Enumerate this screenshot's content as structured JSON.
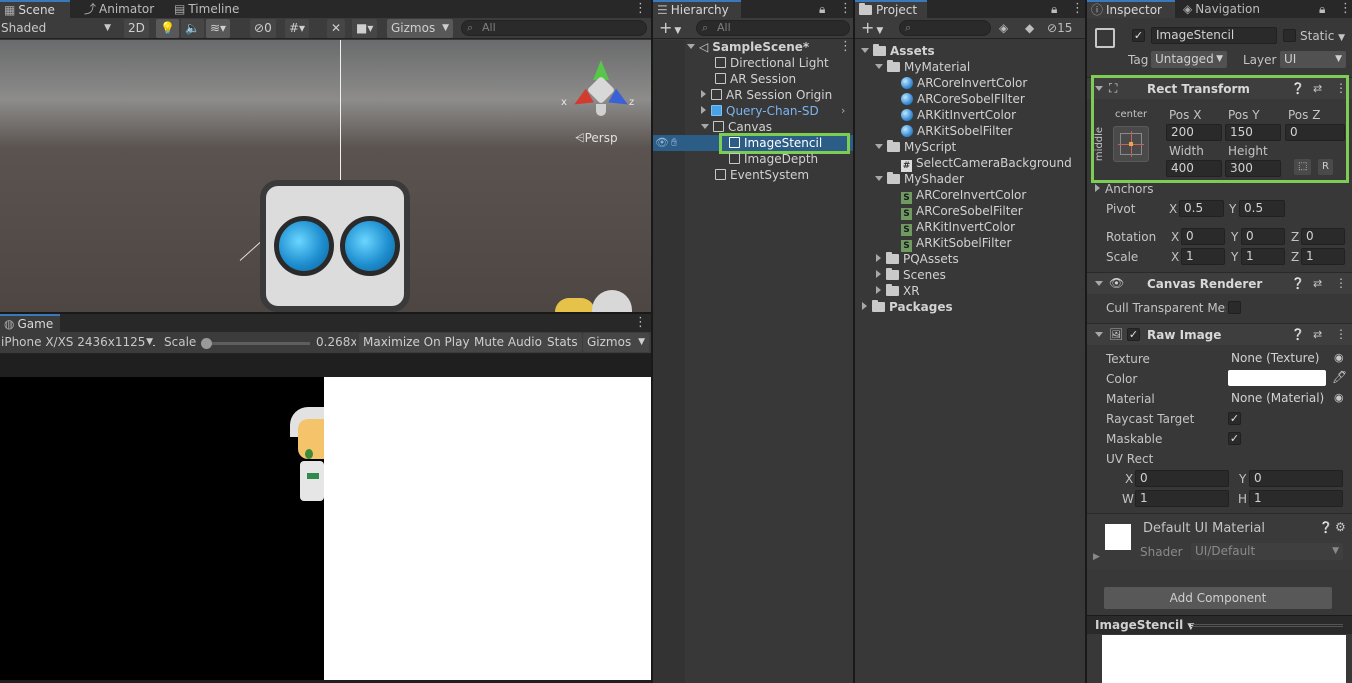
{
  "scene": {
    "tabs": [
      {
        "label": "Scene"
      },
      {
        "label": "Animator"
      },
      {
        "label": "Timeline"
      }
    ],
    "toolbar": {
      "shading": "Shaded",
      "mode_2d": "2D",
      "hidden_count": "0",
      "gizmos": "Gizmos",
      "search_placeholder": "All"
    },
    "persp_label": "Persp",
    "gizmo_axes": {
      "x": "x",
      "z": "z"
    }
  },
  "game": {
    "tab": "Game",
    "resolution": "iPhone X/XS 2436x1125 L",
    "scale_label": "Scale",
    "scale_value": "0.268x",
    "maximize": "Maximize On Play",
    "mute": "Mute Audio",
    "stats": "Stats",
    "gizmos": "Gizmos"
  },
  "hierarchy": {
    "tab": "Hierarchy",
    "search_placeholder": "All",
    "scene_name": "SampleScene*",
    "items": [
      {
        "label": "Directional Light"
      },
      {
        "label": "AR Session"
      },
      {
        "label": "AR Session Origin"
      },
      {
        "label": "Query-Chan-SD"
      },
      {
        "label": "Canvas"
      },
      {
        "label": "ImageStencil"
      },
      {
        "label": "ImageDepth"
      },
      {
        "label": "EventSystem"
      }
    ]
  },
  "project": {
    "tab": "Project",
    "hidden_count": "15",
    "assets": "Assets",
    "folders": [
      {
        "label": "MyMaterial",
        "children": [
          "ARCoreInvertColor",
          "ARCoreSobelFIlter",
          "ARKitInvertColor",
          "ARKitSobelFilter"
        ]
      },
      {
        "label": "MyScript",
        "children": [
          "SelectCameraBackground"
        ]
      },
      {
        "label": "MyShader",
        "children": [
          "ARCoreInvertColor",
          "ARCoreSobelFilter",
          "ARKitInvertColor",
          "ARKitSobelFilter"
        ]
      }
    ],
    "collapsed": [
      "PQAssets",
      "Scenes",
      "XR"
    ],
    "packages": "Packages"
  },
  "inspector": {
    "tabs": [
      {
        "label": "Inspector"
      },
      {
        "label": "Navigation"
      }
    ],
    "object_name": "ImageStencil",
    "static_label": "Static",
    "tag_label": "Tag",
    "tag_value": "Untagged",
    "layer_label": "Layer",
    "layer_value": "UI",
    "rect_transform": {
      "title": "Rect Transform",
      "anchor_h": "center",
      "anchor_v": "middle",
      "pos_x_label": "Pos X",
      "pos_y_label": "Pos Y",
      "pos_z_label": "Pos Z",
      "pos_x": "200",
      "pos_y": "150",
      "pos_z": "0",
      "width_label": "Width",
      "height_label": "Height",
      "width": "400",
      "height": "300",
      "r_button": "R",
      "anchors_label": "Anchors",
      "pivot_label": "Pivot",
      "pivot_x": "0.5",
      "pivot_y": "0.5",
      "rotation_label": "Rotation",
      "rot_x": "0",
      "rot_y": "0",
      "rot_z": "0",
      "scale_label": "Scale",
      "scale_x": "1",
      "scale_y": "1",
      "scale_z": "1",
      "axis_x": "X",
      "axis_y": "Y",
      "axis_z": "Z"
    },
    "canvas_renderer": {
      "title": "Canvas Renderer",
      "cull_label": "Cull Transparent Mes"
    },
    "raw_image": {
      "title": "Raw Image",
      "texture_label": "Texture",
      "texture_value": "None (Texture)",
      "color_label": "Color",
      "material_label": "Material",
      "material_value": "None (Material)",
      "raycast_label": "Raycast Target",
      "maskable_label": "Maskable",
      "uvrect_label": "UV Rect",
      "uv_x_label": "X",
      "uv_x": "0",
      "uv_y_label": "Y",
      "uv_y": "0",
      "uv_w_label": "W",
      "uv_w": "1",
      "uv_h_label": "H",
      "uv_h": "1"
    },
    "material": {
      "name": "Default UI Material",
      "shader_label": "Shader",
      "shader_value": "UI/Default"
    },
    "add_component": "Add Component",
    "preview_title": "ImageStencil"
  },
  "colors": {
    "highlight": "#7dcd52",
    "selection": "#2c5d87",
    "accent_blue": "#3a79bb"
  }
}
